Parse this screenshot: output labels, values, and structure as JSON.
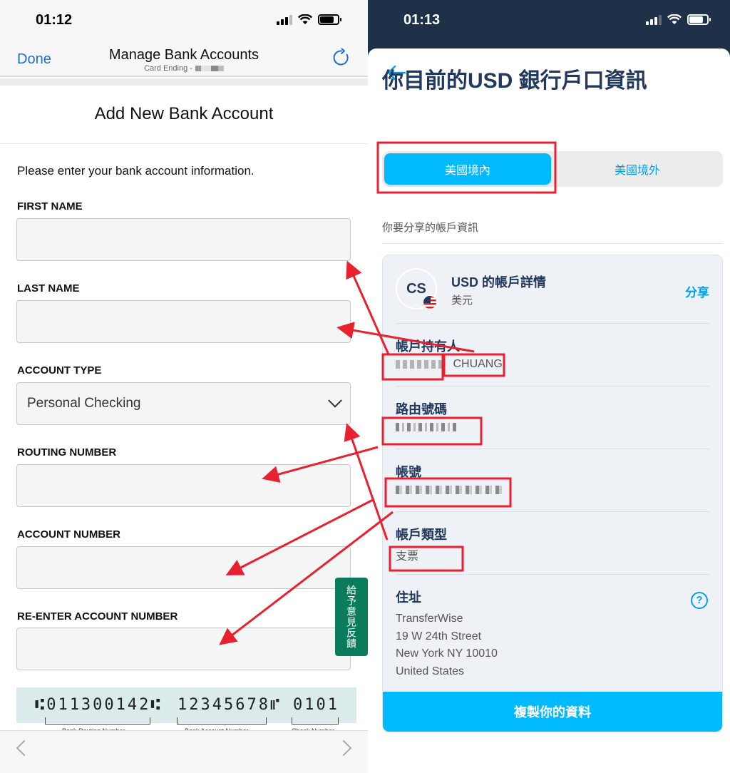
{
  "left": {
    "status": {
      "time": "01:12"
    },
    "nav": {
      "done_label": "Done",
      "title": "Manage Bank Accounts",
      "subtitle": "Card Ending -",
      "refresh_icon": "refresh-icon"
    },
    "heading": "Add New Bank Account",
    "intro": "Please enter your bank account information.",
    "fields": [
      {
        "label": "FIRST NAME",
        "value": "",
        "type": "text"
      },
      {
        "label": "LAST NAME",
        "value": "",
        "type": "text"
      },
      {
        "label": "ACCOUNT TYPE",
        "value": "Personal Checking",
        "type": "select"
      },
      {
        "label": "ROUTING NUMBER",
        "value": "",
        "type": "text"
      },
      {
        "label": "ACCOUNT NUMBER",
        "value": "",
        "type": "text"
      },
      {
        "label": "RE-ENTER ACCOUNT NUMBER",
        "value": "",
        "type": "text"
      }
    ],
    "feedback_label": "給予意見反饋",
    "check_image": {
      "routing": "⑆011300142⑆",
      "account": "12345678⑈",
      "check": "0101",
      "captions": [
        "Bank Routing Number",
        "Bank Account Number",
        "Check Number"
      ]
    },
    "bottom_nav": {
      "back_icon": "chevron-left-icon",
      "forward_icon": "chevron-right-icon"
    }
  },
  "right": {
    "status": {
      "time": "01:13"
    },
    "back_icon": "arrow-left-icon",
    "title": "你目前的USD 銀行戶口資訊",
    "segments": [
      {
        "label": "美國境內",
        "active": true
      },
      {
        "label": "美國境外",
        "active": false
      }
    ],
    "subtitle": "你要分享的帳戶資訊",
    "card": {
      "avatar_initials": "CS",
      "title": "USD 的帳戶詳情",
      "currency": "美元",
      "share_label": "分享",
      "fields": [
        {
          "label": "帳戶持有人",
          "value": "CHUANG",
          "redacted_prefix": true
        },
        {
          "label": "路由號碼",
          "value": "",
          "redacted": true
        },
        {
          "label": "帳號",
          "value": "",
          "redacted": true
        },
        {
          "label": "帳戶類型",
          "value": "支票"
        }
      ],
      "address": {
        "label": "住址",
        "lines": [
          "TransferWise",
          "19 W 24th Street",
          "New York NY 10010",
          "United States"
        ]
      },
      "copy_label": "複製你的資料"
    }
  },
  "annotation_color": "#e8202f"
}
